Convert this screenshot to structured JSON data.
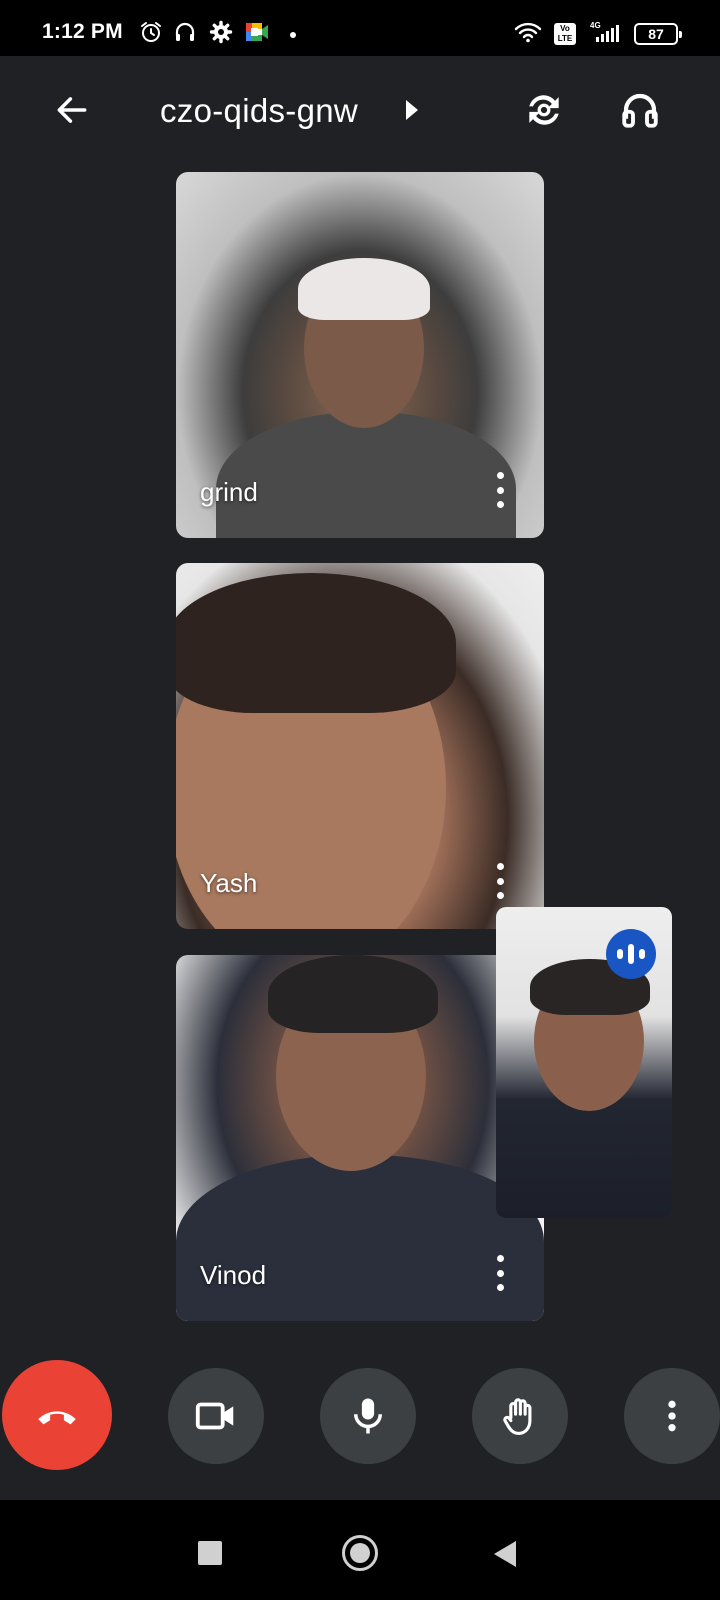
{
  "status_bar": {
    "time": "1:12 PM",
    "battery": "87",
    "volte": "Vo\nLTE",
    "network": "4G"
  },
  "header": {
    "meeting_code": "czo-qids-gnw"
  },
  "participants": [
    {
      "name": "grind"
    },
    {
      "name": "Yash"
    },
    {
      "name": "Vinod"
    }
  ],
  "colors": {
    "background": "#202124",
    "end_call": "#ea4335",
    "control_bg": "#3c4043",
    "speaking_badge": "#1a55c4"
  }
}
